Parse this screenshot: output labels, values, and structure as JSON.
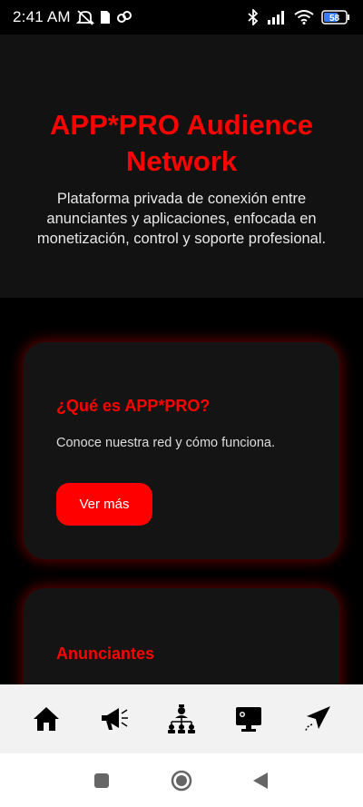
{
  "status_bar": {
    "time": "2:41 AM",
    "battery_label": "58",
    "icons": [
      "mute-icon",
      "sim-icon",
      "link-icon",
      "bluetooth-icon",
      "signal-icon",
      "wifi-icon",
      "battery-icon"
    ]
  },
  "hero": {
    "title": "APP*PRO Audience Network",
    "subtitle": "Plataforma privada de conexión entre anunciantes y aplicaciones, enfocada en monetización, control y soporte profesional."
  },
  "cards": [
    {
      "title": "¿Qué es APP*PRO?",
      "text": "Conoce nuestra red y cómo funciona.",
      "button_label": "Ver más"
    },
    {
      "title": "Anunciantes",
      "text": ""
    }
  ],
  "bottom_nav": {
    "items": [
      "home-icon",
      "megaphone-icon",
      "network-icon",
      "monitor-icon",
      "send-icon"
    ]
  },
  "system_nav": {
    "items": [
      "recents-button",
      "home-button",
      "back-button"
    ]
  },
  "colors": {
    "accent": "#ff0000",
    "background": "#000000",
    "hero_bg": "#121212",
    "card_bg": "#141414",
    "nav_bg": "#f2f2f2"
  }
}
